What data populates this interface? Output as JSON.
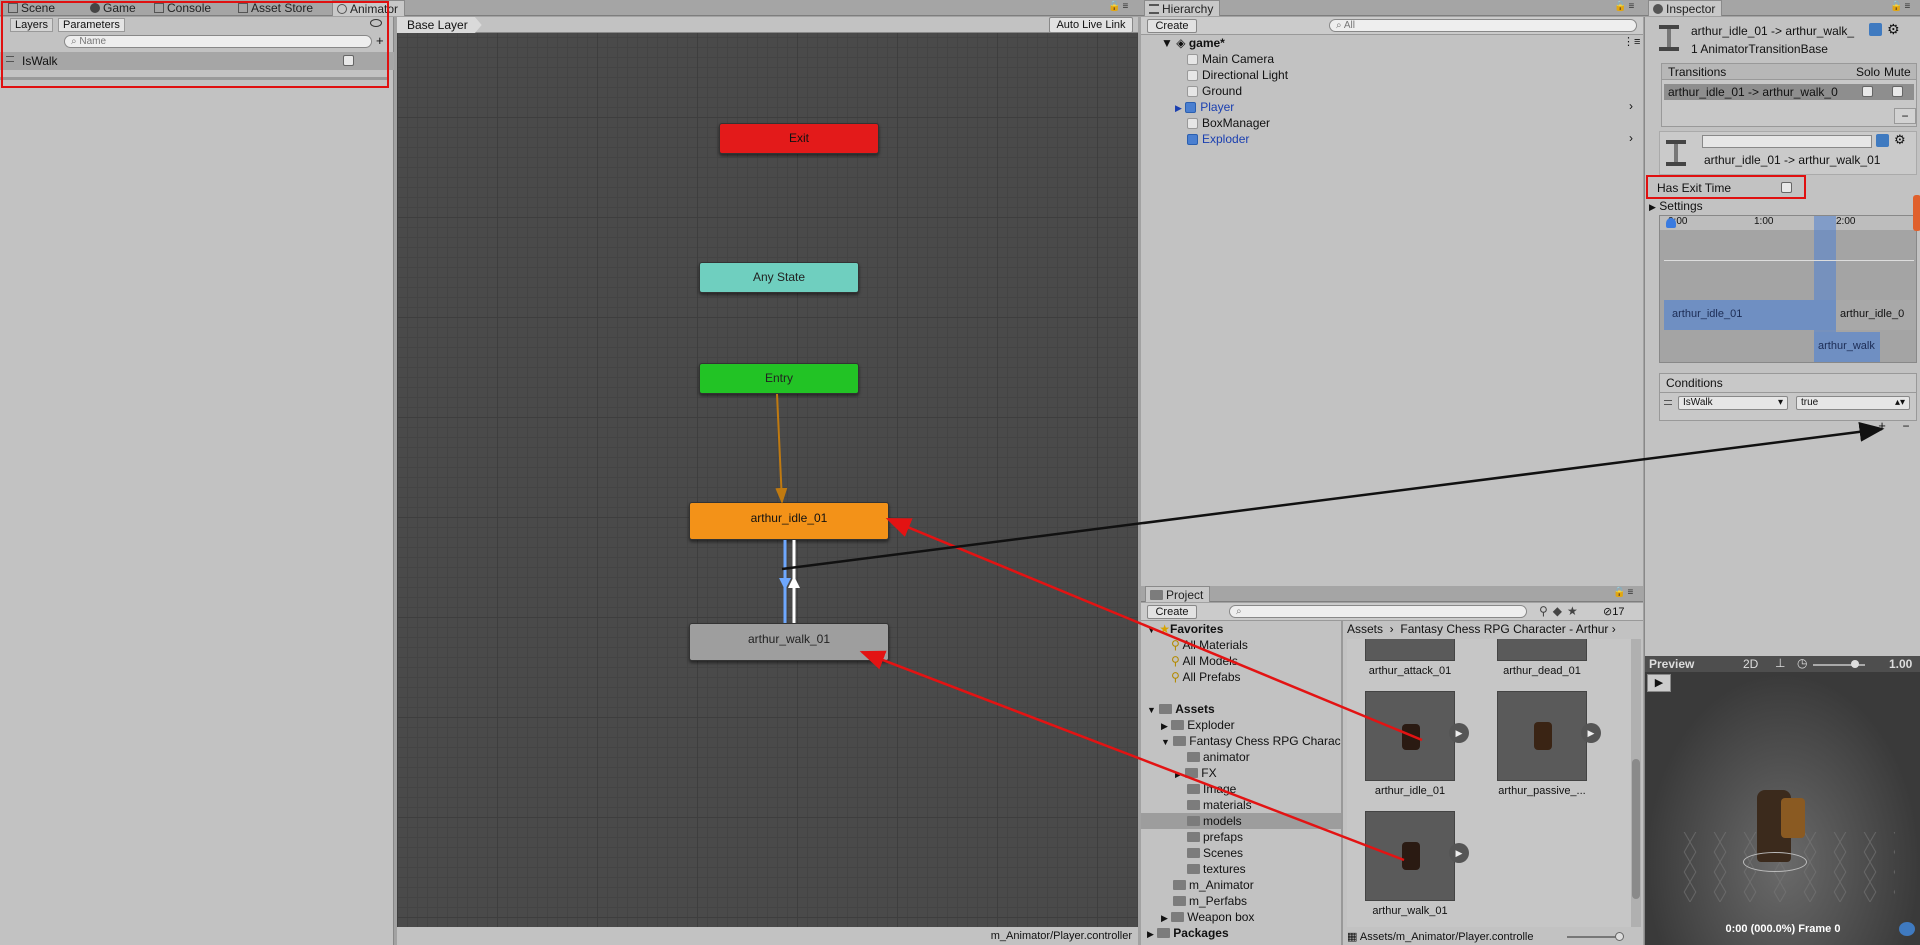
{
  "tabs": {
    "scene": "Scene",
    "game": "Game",
    "console": "Console",
    "asset_store": "Asset Store",
    "animator": "Animator",
    "hierarchy": "Hierarchy",
    "inspector": "Inspector",
    "project": "Project"
  },
  "animator": {
    "layers_tab": "Layers",
    "parameters_tab": "Parameters",
    "search_placeholder": "Name",
    "parameter_name": "IsWalk",
    "breadcrumb": "Base Layer",
    "auto_live_link": "Auto Live Link",
    "nodes": {
      "exit": "Exit",
      "any_state": "Any State",
      "entry": "Entry",
      "idle": "arthur_idle_01",
      "walk": "arthur_walk_01"
    },
    "status_path": "m_Animator/Player.controller",
    "colors": {
      "exit": "#e31a1a",
      "any_state": "#6fcfbf",
      "entry": "#22c325",
      "idle": "#f39218",
      "walk": "#9e9e9e"
    }
  },
  "hierarchy": {
    "create_label": "Create",
    "search_placeholder": "All",
    "scene_name": "game*",
    "items": [
      {
        "label": "Main Camera",
        "prefab": false
      },
      {
        "label": "Directional Light",
        "prefab": false
      },
      {
        "label": "Ground",
        "prefab": false
      },
      {
        "label": "Player",
        "prefab": true
      },
      {
        "label": "BoxManager",
        "prefab": false
      },
      {
        "label": "Exploder",
        "prefab": true
      }
    ]
  },
  "project": {
    "create_label": "Create",
    "visible_count": "17",
    "favorites_label": "Favorites",
    "favorites": [
      "All Materials",
      "All Models",
      "All Prefabs"
    ],
    "assets_label": "Assets",
    "tree": [
      {
        "label": "Exploder",
        "depth": 1
      },
      {
        "label": "Fantasy Chess RPG Charac",
        "depth": 1
      },
      {
        "label": "animator",
        "depth": 2
      },
      {
        "label": "FX",
        "depth": 2
      },
      {
        "label": "Image",
        "depth": 2
      },
      {
        "label": "materials",
        "depth": 2
      },
      {
        "label": "models",
        "depth": 2
      },
      {
        "label": "prefaps",
        "depth": 2
      },
      {
        "label": "Scenes",
        "depth": 2
      },
      {
        "label": "textures",
        "depth": 2
      },
      {
        "label": "m_Animator",
        "depth": 1
      },
      {
        "label": "m_Perfabs",
        "depth": 1
      },
      {
        "label": "Weapon box",
        "depth": 1
      }
    ],
    "packages_label": "Packages",
    "breadcrumb_root": "Assets",
    "breadcrumb_folder": "Fantasy Chess RPG Character - Arthur",
    "assets_grid": [
      "arthur_attack_01",
      "arthur_dead_01",
      "arthur_idle_01",
      "arthur_passive_...",
      "arthur_walk_01"
    ],
    "footer_path": "Assets/m_Animator/Player.controlle"
  },
  "inspector": {
    "title": "arthur_idle_01 -> arthur_walk_",
    "subtitle": "1 AnimatorTransitionBase",
    "transitions_header": "Transitions",
    "solo_label": "Solo",
    "mute_label": "Mute",
    "transition_row": "arthur_idle_01 -> arthur_walk_0",
    "minus": "−",
    "transition_name": "arthur_idle_01 -> arthur_walk_01",
    "has_exit_time_label": "Has Exit Time",
    "settings_label": "Settings",
    "timeline_ticks": [
      "0:00",
      "1:00",
      "2:00"
    ],
    "timeline_clip_a": "arthur_idle_01",
    "timeline_clip_a2": "arthur_idle_0",
    "timeline_clip_b": "arthur_walk",
    "conditions_header": "Conditions",
    "condition_param": "IsWalk",
    "condition_value": "true",
    "plus": "+",
    "preview_label": "Preview",
    "preview_2d": "2D",
    "preview_speed": "1.00",
    "preview_frame": "0:00 (000.0%) Frame 0"
  }
}
